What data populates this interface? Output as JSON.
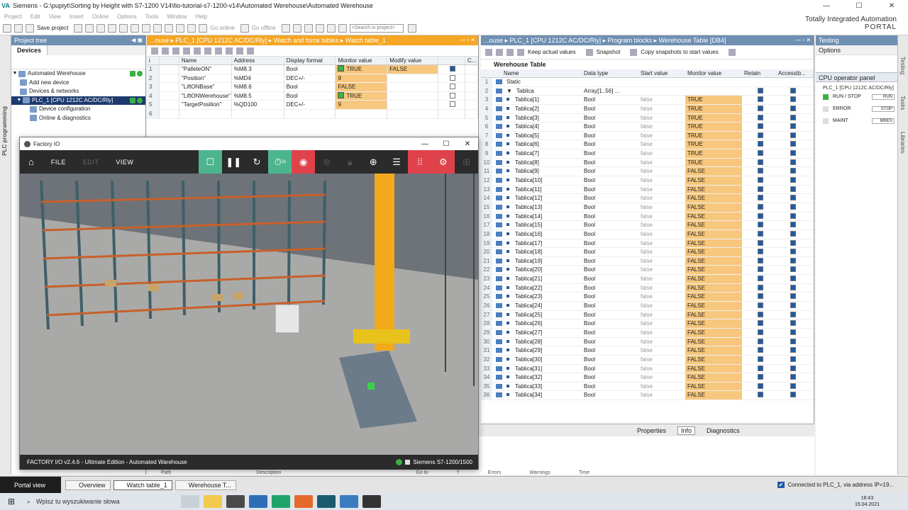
{
  "window": {
    "title": "Siemens  -  G:\\pupiyt\\Sorting by Height with S7-1200 V14\\fio-tutorial-s7-1200-v14\\Automated Werehouse\\Automated Werehouse",
    "min": "—",
    "max": "☐",
    "close": "✕"
  },
  "menu": [
    "Project",
    "Edit",
    "View",
    "Insert",
    "Online",
    "Options",
    "Tools",
    "Window",
    "Help"
  ],
  "toolbar": {
    "save_label": "Save project",
    "go_online": "Go online",
    "go_offline": "Go offline",
    "search_placeholder": "<Search in project>"
  },
  "brand": {
    "line1": "Totally Integrated Automation",
    "line2": "PORTAL"
  },
  "left_strip": "PLC programming",
  "project_tree": {
    "header": "Project tree",
    "tab": "Devices",
    "items": [
      {
        "label": "Automated Werehouse",
        "exp": "▼"
      },
      {
        "label": "Add new device",
        "exp": ""
      },
      {
        "label": "Devices & networks",
        "exp": ""
      },
      {
        "label": "PLC_1 [CPU 1212C AC/DC/Rly]",
        "exp": "▼"
      },
      {
        "label": "Device configuration",
        "exp": ""
      },
      {
        "label": "Online & diagnostics",
        "exp": ""
      }
    ]
  },
  "watch": {
    "breadcrumb": "...ouse  ▸  PLC_1 [CPU 1212C AC/DC/Rly]  ▸  Watch and force tables  ▸  Watch table_1",
    "cols": [
      "i",
      "Name",
      "Address",
      "Display format",
      "Monitor value",
      "Modify value",
      "",
      "C..."
    ],
    "rows": [
      {
        "n": "1",
        "name": "\"PalleteON\"",
        "addr": "%M8.3",
        "fmt": "Bool",
        "mon": "TRUE",
        "mod": "FALSE"
      },
      {
        "n": "2",
        "name": "\"Position\"",
        "addr": "%MD4",
        "fmt": "DEC+/-",
        "mon": "9",
        "mod": ""
      },
      {
        "n": "3",
        "name": "\"LiftONBase\"",
        "addr": "%M8.6",
        "fmt": "Bool",
        "mon": "FALSE",
        "mod": ""
      },
      {
        "n": "4",
        "name": "\"LiftONWerehouse\"",
        "addr": "%M8.5",
        "fmt": "Bool",
        "mon": "TRUE",
        "mod": ""
      },
      {
        "n": "5",
        "name": "\"TargetPosition\"",
        "addr": "%QD100",
        "fmt": "DEC+/-",
        "mon": "9",
        "mod": ""
      },
      {
        "n": "6",
        "name": "",
        "addr": "",
        "fmt": "",
        "mon": "",
        "mod": ""
      }
    ]
  },
  "fio": {
    "title": "Factory IO",
    "menus": {
      "file": "FILE",
      "edit": "EDIT",
      "view": "VIEW"
    },
    "status_left": "FACTORY I/O v2.4.6 - Ultimate Edition - Automated Warehouse",
    "status_right": "Siemens S7-1200/1500",
    "speed": "2x"
  },
  "db": {
    "breadcrumb": "...ouse  ▸  PLC_1 [CPU 1212C AC/DC/Rly]  ▸  Program blocks  ▸  Werehouse Table [DB4]",
    "keep": "Keep actual values",
    "snapshot": "Snapshot",
    "copy": "Copy snapshots to start values",
    "name": "Werehouse Table",
    "cols": [
      "",
      "Name",
      "Data type",
      "Start value",
      "Monitor value",
      "Retain",
      "Accessib..."
    ],
    "static": "Static",
    "tablica": "Tablica",
    "array_type": "Array[1..56] ...",
    "elem_type": "Bool",
    "start": "false",
    "monitor": [
      "TRUE",
      "TRUE",
      "TRUE",
      "TRUE",
      "TRUE",
      "TRUE",
      "TRUE",
      "TRUE",
      "FALSE",
      "FALSE",
      "FALSE",
      "FALSE",
      "FALSE",
      "FALSE",
      "FALSE",
      "FALSE",
      "FALSE",
      "FALSE",
      "FALSE",
      "FALSE",
      "FALSE",
      "FALSE",
      "FALSE",
      "FALSE",
      "FALSE",
      "FALSE",
      "FALSE",
      "FALSE",
      "FALSE",
      "FALSE",
      "FALSE",
      "FALSE",
      "FALSE",
      "FALSE"
    ]
  },
  "inspector": {
    "properties": "Properties",
    "info": "Info",
    "diagnostics": "Diagnostics"
  },
  "below_cols": [
    "Path",
    "Description",
    "Go to",
    "?",
    "Errors",
    "Warnings",
    "Time"
  ],
  "tasks": {
    "header": "Testing",
    "options": "Options",
    "section": "CPU operator panel",
    "cpu": "PLC_1 [CPU 1212C AC/DC/Rly]",
    "leds": [
      {
        "label": "RUN / STOP",
        "btn": "RUN"
      },
      {
        "label": "ERROR",
        "btn": "STOP"
      },
      {
        "label": "MAINT",
        "btn": "MRES"
      }
    ],
    "side": [
      "Testing",
      "Tasks",
      "Libraries"
    ]
  },
  "tiabar": {
    "portal": "Portal view",
    "tabs": [
      "Overview",
      "Watch table_1",
      "Werehouse T..."
    ],
    "conn": "Connected to PLC_1, via address IP=19..."
  },
  "taskbar": {
    "search": "Wpisz tu wyszukiwanie słowa",
    "time": "16:43",
    "date": "15.04.2021"
  }
}
